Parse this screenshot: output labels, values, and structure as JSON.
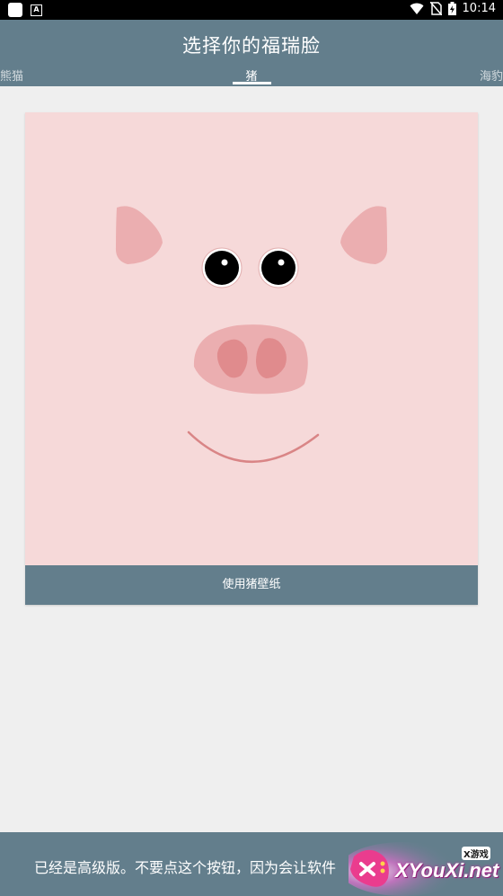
{
  "status_bar": {
    "time": "10:14",
    "icons": [
      "app-square-icon",
      "a-icon",
      "wifi-icon",
      "no-sim-icon",
      "battery-charging-icon"
    ]
  },
  "header": {
    "title": "选择你的福瑞脸",
    "tabs": [
      {
        "label": "熊猫",
        "selected": false
      },
      {
        "label": "猪",
        "selected": true
      },
      {
        "label": "海豹",
        "selected": false
      }
    ]
  },
  "card": {
    "button_label": "使用猪壁纸",
    "colors": {
      "background": "#f6d9d9",
      "ears": "#ebaeb0",
      "snout": "#ebaeb0",
      "nostrils": "#e08b8d",
      "smile": "#d98586"
    }
  },
  "bottom_bar": {
    "text": "已经是高级版。不要点这个按钮，因为会让软件"
  },
  "watermark": {
    "site": "XYouXi.net",
    "brand": "X游戏"
  },
  "theme": {
    "primary": "#637e8c",
    "page_background": "#efefef"
  }
}
